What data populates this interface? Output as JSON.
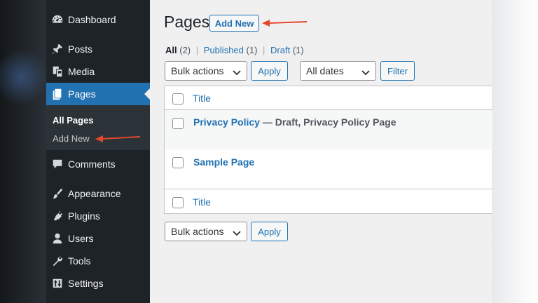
{
  "sidebar": {
    "items": [
      {
        "label": "Dashboard",
        "icon": "dashboard-icon"
      },
      {
        "label": "Posts",
        "icon": "pin-icon"
      },
      {
        "label": "Media",
        "icon": "media-icon"
      },
      {
        "label": "Pages",
        "icon": "pages-icon",
        "active": true
      },
      {
        "label": "Comments",
        "icon": "comment-icon"
      },
      {
        "label": "Appearance",
        "icon": "brush-icon"
      },
      {
        "label": "Plugins",
        "icon": "plug-icon"
      },
      {
        "label": "Users",
        "icon": "user-icon"
      },
      {
        "label": "Tools",
        "icon": "wrench-icon"
      },
      {
        "label": "Settings",
        "icon": "settings-icon"
      }
    ],
    "submenu": [
      "All Pages",
      "Add New"
    ]
  },
  "header": {
    "title": "Pages",
    "add_new": "Add New"
  },
  "views": {
    "all": "All",
    "all_count": "(2)",
    "published": "Published",
    "published_count": "(1)",
    "draft": "Draft",
    "draft_count": "(1)",
    "separator": "|"
  },
  "toolbar": {
    "bulk_actions": "Bulk actions",
    "apply": "Apply",
    "dates": "All dates",
    "filter": "Filter"
  },
  "table": {
    "column_title": "Title",
    "rows": [
      {
        "title": "Privacy Policy",
        "state": " — Draft, Privacy Policy Page"
      },
      {
        "title": "Sample Page",
        "state": ""
      }
    ]
  },
  "colors": {
    "accent": "#2271b1",
    "sidebar_bg": "#1d2327",
    "annotation_arrow": "#e4472b"
  }
}
